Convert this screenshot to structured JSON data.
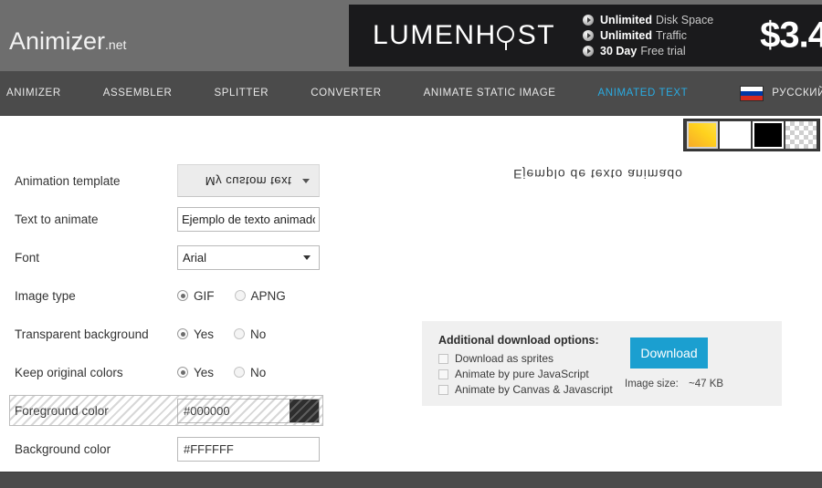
{
  "site": {
    "logo_pre": "Animi",
    "logo_z": "z",
    "logo_post": "er",
    "logo_tld": ".net"
  },
  "banner": {
    "brand_pre": "LUMENH",
    "brand_post": "ST",
    "features": [
      {
        "strong": "Unlimited",
        "rest": "Disk Space"
      },
      {
        "strong": "Unlimited",
        "rest": "Traffic"
      },
      {
        "strong": "30 Day",
        "rest": "Free trial"
      }
    ],
    "price": "$3.4"
  },
  "nav": {
    "items": [
      {
        "label": "ANIMIZER",
        "active": false
      },
      {
        "label": "ASSEMBLER",
        "active": false
      },
      {
        "label": "SPLITTER",
        "active": false
      },
      {
        "label": "CONVERTER",
        "active": false
      },
      {
        "label": "ANIMATE STATIC IMAGE",
        "active": false
      },
      {
        "label": "ANIMATED TEXT",
        "active": true
      }
    ],
    "language": "РУССКИЙ",
    "active_color": "#29abe2"
  },
  "form": {
    "animation_template": {
      "label": "Animation template",
      "value": "My custom text"
    },
    "text_to_animate": {
      "label": "Text to animate",
      "value": "Ejemplo de texto animado",
      "placeholder": ""
    },
    "font": {
      "label": "Font",
      "value": "Arial"
    },
    "image_type": {
      "label": "Image type",
      "options": [
        "GIF",
        "APNG"
      ],
      "selected": "GIF"
    },
    "transparent_background": {
      "label": "Transparent background",
      "options": [
        "Yes",
        "No"
      ],
      "selected": "Yes"
    },
    "keep_original_colors": {
      "label": "Keep original colors",
      "options": [
        "Yes",
        "No"
      ],
      "selected": "Yes"
    },
    "foreground_color": {
      "label": "Foreground color",
      "value": "#000000",
      "swatch": "#2e2e2e",
      "disabled": true
    },
    "background_color": {
      "label": "Background color",
      "value": "#FFFFFF",
      "swatch": "#FFFFFF",
      "disabled": false
    }
  },
  "preview": {
    "text": "Ejemplo de texto animado",
    "palette": [
      {
        "name": "yellow-gradient",
        "selected": true
      },
      {
        "name": "white",
        "selected": false
      },
      {
        "name": "black",
        "selected": false
      },
      {
        "name": "transparent-checker",
        "selected": false
      }
    ]
  },
  "download": {
    "title": "Additional download options:",
    "options": [
      {
        "label": "Download as sprites",
        "checked": false
      },
      {
        "label": "Animate by pure JavaScript",
        "checked": false
      },
      {
        "label": "Animate by Canvas & Javascript",
        "checked": false
      }
    ],
    "button": "Download",
    "size_label": "Image size:",
    "size_value": "~47 KB",
    "button_color": "#1b9fd0"
  }
}
